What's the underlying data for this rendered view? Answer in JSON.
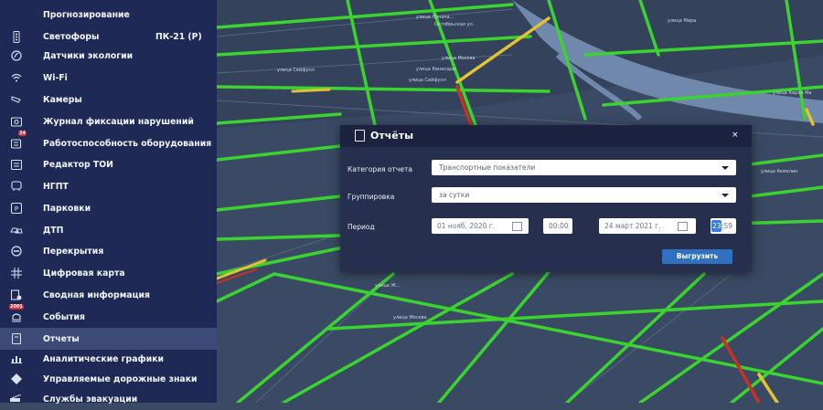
{
  "sidebar": {
    "items": [
      {
        "label": "Прогнозирование",
        "icon": "forecast-icon"
      },
      {
        "label": "Светофоры",
        "extra": "ПК-21 (Р)",
        "icon": "traffic-light-icon"
      },
      {
        "label": "Датчики экологии",
        "icon": "ecology-sensor-icon"
      },
      {
        "label": "Wi-Fi",
        "icon": "wifi-icon"
      },
      {
        "label": "Камеры",
        "icon": "camera-icon"
      },
      {
        "label": "Журнал фиксации нарушений",
        "icon": "violations-journal-icon"
      },
      {
        "label": "Работоспособность оборудования",
        "icon": "equipment-health-icon",
        "badge": "24"
      },
      {
        "label": "Редактор ТОИ",
        "icon": "toi-editor-icon"
      },
      {
        "label": "НГПТ",
        "icon": "public-transport-icon"
      },
      {
        "label": "Парковки",
        "icon": "parking-icon"
      },
      {
        "label": "ДТП",
        "icon": "accident-icon"
      },
      {
        "label": "Перекрытия",
        "icon": "road-closure-icon"
      },
      {
        "label": "Цифровая карта",
        "icon": "digital-map-icon"
      },
      {
        "label": "Сводная информация",
        "icon": "summary-icon"
      },
      {
        "label": "События",
        "icon": "events-icon",
        "badge": "2001"
      },
      {
        "label": "Отчеты",
        "icon": "reports-icon",
        "active": true
      },
      {
        "label": "Аналитические графики",
        "icon": "analytics-chart-icon"
      },
      {
        "label": "Управляемые дорожные знаки",
        "icon": "road-sign-icon"
      },
      {
        "label": "Службы эвакуации",
        "icon": "tow-truck-icon"
      }
    ]
  },
  "map": {
    "streets": [
      "улица Лунача...",
      "Октябрьская ул.",
      "улица Москва",
      "улица Сейфулл",
      "улица Кенесары",
      "улица Сейфулл",
      "улица Мира",
      "улица Карла Ма",
      "улица Акмолин",
      "улица Ж...",
      "улица Москва"
    ]
  },
  "dialog": {
    "title": "Отчёты",
    "close": "×",
    "category_label": "Категория отчета",
    "category_value": "Транспортные показатели",
    "grouping_label": "Группировка",
    "grouping_value": "за сутки",
    "period_label": "Период",
    "date_from": "01 нояб. 2020 г.",
    "time_from": "00:00",
    "date_to": "24 март 2021 г.",
    "time_to_hours": "23",
    "time_to_minutes": ":59",
    "export_button": "Выгрузить"
  },
  "colors": {
    "sidebar_bg": "#1e2a55",
    "road_green": "#3bd32f",
    "road_red": "#c93223",
    "road_yellow": "#e2c234",
    "river": "#6f88ac",
    "button": "#2f71c0"
  }
}
